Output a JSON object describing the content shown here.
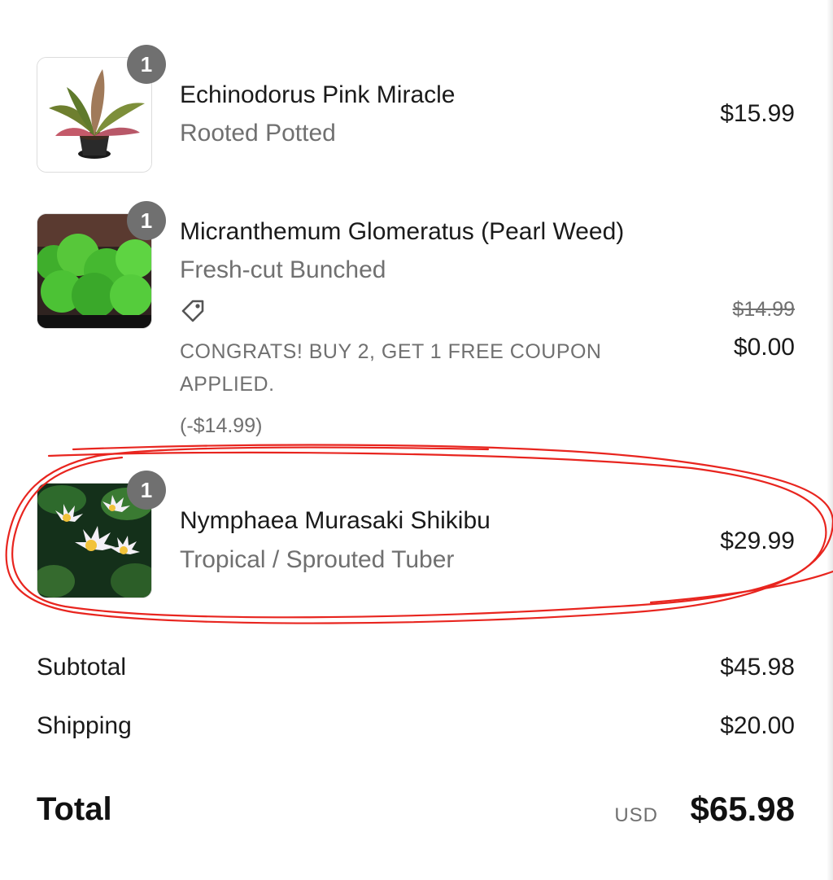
{
  "cart": {
    "items": [
      {
        "quantity": "1",
        "name": "Echinodorus Pink Miracle",
        "variant": "Rooted Potted",
        "price": "$15.99",
        "thumbnail_icon": "potted-plant-image"
      },
      {
        "quantity": "1",
        "name": "Micranthemum Glomeratus (Pearl Weed)",
        "variant": "Fresh-cut Bunched",
        "original_price": "$14.99",
        "price": "$0.00",
        "coupon_icon": "tag-icon",
        "coupon_text": "CONGRATS! BUY 2, GET 1 FREE COUPON APPLIED.",
        "discount": "(-$14.99)",
        "thumbnail_icon": "aquarium-plants-image"
      },
      {
        "quantity": "1",
        "name": "Nymphaea Murasaki Shikibu",
        "variant": "Tropical / Sprouted Tuber",
        "price": "$29.99",
        "thumbnail_icon": "water-lily-image",
        "highlighted": true
      }
    ]
  },
  "summary": {
    "subtotal_label": "Subtotal",
    "subtotal_value": "$45.98",
    "shipping_label": "Shipping",
    "shipping_value": "$20.00",
    "total_label": "Total",
    "total_currency": "USD",
    "total_value": "$65.98"
  },
  "colors": {
    "badge": "#707070",
    "muted_text": "#707070",
    "annotation": "#e8251f"
  }
}
